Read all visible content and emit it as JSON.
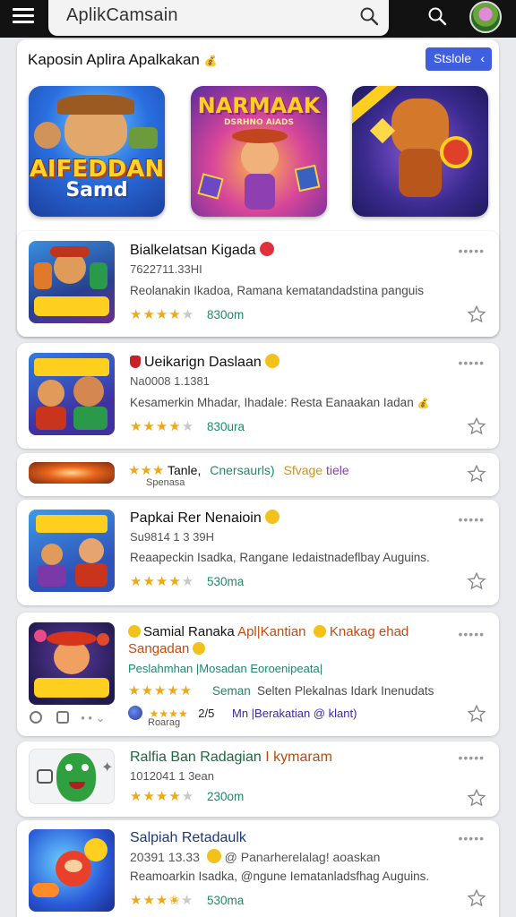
{
  "header": {
    "search_text": "AplikCamsain"
  },
  "section": {
    "title": "Kaposin Aplira Apalkakan",
    "title_emoji": "💰",
    "button_label": "Stslole",
    "button_chevron": "‹"
  },
  "featured": [
    {
      "line1": "AIFEDDAN",
      "line2": "Samd"
    },
    {
      "line1": "NARMAAK",
      "line2": "DSRHNO AIADS"
    },
    {
      "line1": "",
      "line2": ""
    }
  ],
  "apps": [
    {
      "name": "Bialkelatsan Kigada",
      "meta": "7622711.33HI",
      "desc": "Reolanakin Ikadoa, Ramana kematandadstina panguis",
      "rating": 4,
      "count": "830om",
      "more": "•••••"
    },
    {
      "name": "Ueikarign Daslaan",
      "meta": "Na0008 1.1381",
      "desc": "Kesamerkin Mhadar, Ihadale: Resta Eanaakan Iadan",
      "rating": 4,
      "count": "830ura",
      "more": "•••••"
    },
    {
      "name": "Tanle,",
      "tag1": "Cnersaurls)",
      "tag2": "Sfvage",
      "tag3": "tiele",
      "sub": "Spenasa"
    },
    {
      "name": "Papkai Rer Nenaioin",
      "meta": "Su9814 1 3 39H",
      "desc": "Reaapeckin Isadka, Rangane Iedaistnadeflbay Auguins.",
      "rating": 4,
      "count": "530ma",
      "more": "•••••"
    },
    {
      "name_prefix": "Samial Ranaka",
      "name_accent": "Apl|Kantian",
      "name_tail": "Knakag ehad",
      "name_line2": "Sangadan",
      "meta": "Peslahmhan |Mosadan Eoroenipeata|",
      "rating": 5,
      "count": "Seman",
      "desc": "Selten Plekalnas Idark Inenudats",
      "row3_stars_label": "Roarag",
      "row3_num": "2/5",
      "row3_text1": "Mn",
      "row3_text2": "|Berakatian @ klant)",
      "more": "•••••"
    },
    {
      "name": "Ralfia Ban Radagian",
      "name_tail": "I kymaram",
      "meta": "1012041 1 3ean",
      "rating": 4,
      "count": "230om",
      "more": "•••••"
    },
    {
      "name": "Salpiah Retadaulk",
      "meta": "20391 13.33",
      "meta_tail": "@ Panarherelalag! aoaskan",
      "desc": "Reamoarkin Isadka, @ngune Iematanladsfhag Auguins.",
      "rating": 3.5,
      "count": "530ma",
      "more": "•••••"
    }
  ]
}
